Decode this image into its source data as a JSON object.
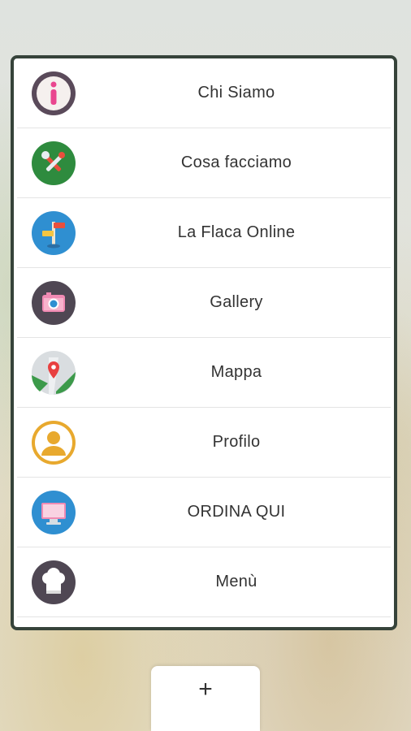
{
  "menu": {
    "items": [
      {
        "label": "Chi Siamo",
        "icon": "info-icon"
      },
      {
        "label": "Cosa facciamo",
        "icon": "tools-icon"
      },
      {
        "label": "La Flaca Online",
        "icon": "signpost-icon"
      },
      {
        "label": "Gallery",
        "icon": "camera-icon"
      },
      {
        "label": "Mappa",
        "icon": "map-pin-icon"
      },
      {
        "label": "Profilo",
        "icon": "user-icon"
      },
      {
        "label": "ORDINA QUI",
        "icon": "monitor-icon"
      },
      {
        "label": "Menù",
        "icon": "chef-hat-icon"
      }
    ]
  },
  "add_tab": {
    "symbol": "+"
  },
  "colors": {
    "panel_border": "#36433a",
    "info_bg": "#5a4a5a",
    "tools_bg": "#2e8b3e",
    "signpost_bg": "#2f8fd1",
    "camera_bg": "#4f4753",
    "map_bg": "#d9dde0",
    "user_bg": "#e8a92e",
    "monitor_bg": "#2f8fd1",
    "chef_bg": "#4f4753"
  }
}
